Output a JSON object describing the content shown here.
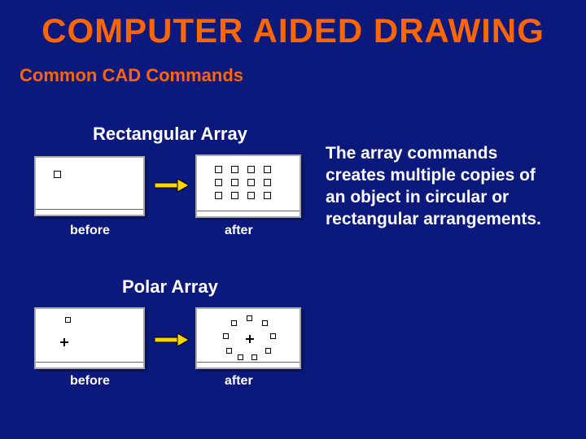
{
  "title": "COMPUTER AIDED DRAWING",
  "subtitle": "Common CAD Commands",
  "sections": {
    "rect": {
      "heading": "Rectangular Array",
      "before": "before",
      "after": "after"
    },
    "polar": {
      "heading": "Polar Array",
      "before": "before",
      "after": "after"
    }
  },
  "description": "The array commands creates multiple copies of an object in circular or rectangular arrangements.",
  "colors": {
    "bg": "#0b197d",
    "accent": "#ff6600",
    "text": "#ffffff"
  }
}
